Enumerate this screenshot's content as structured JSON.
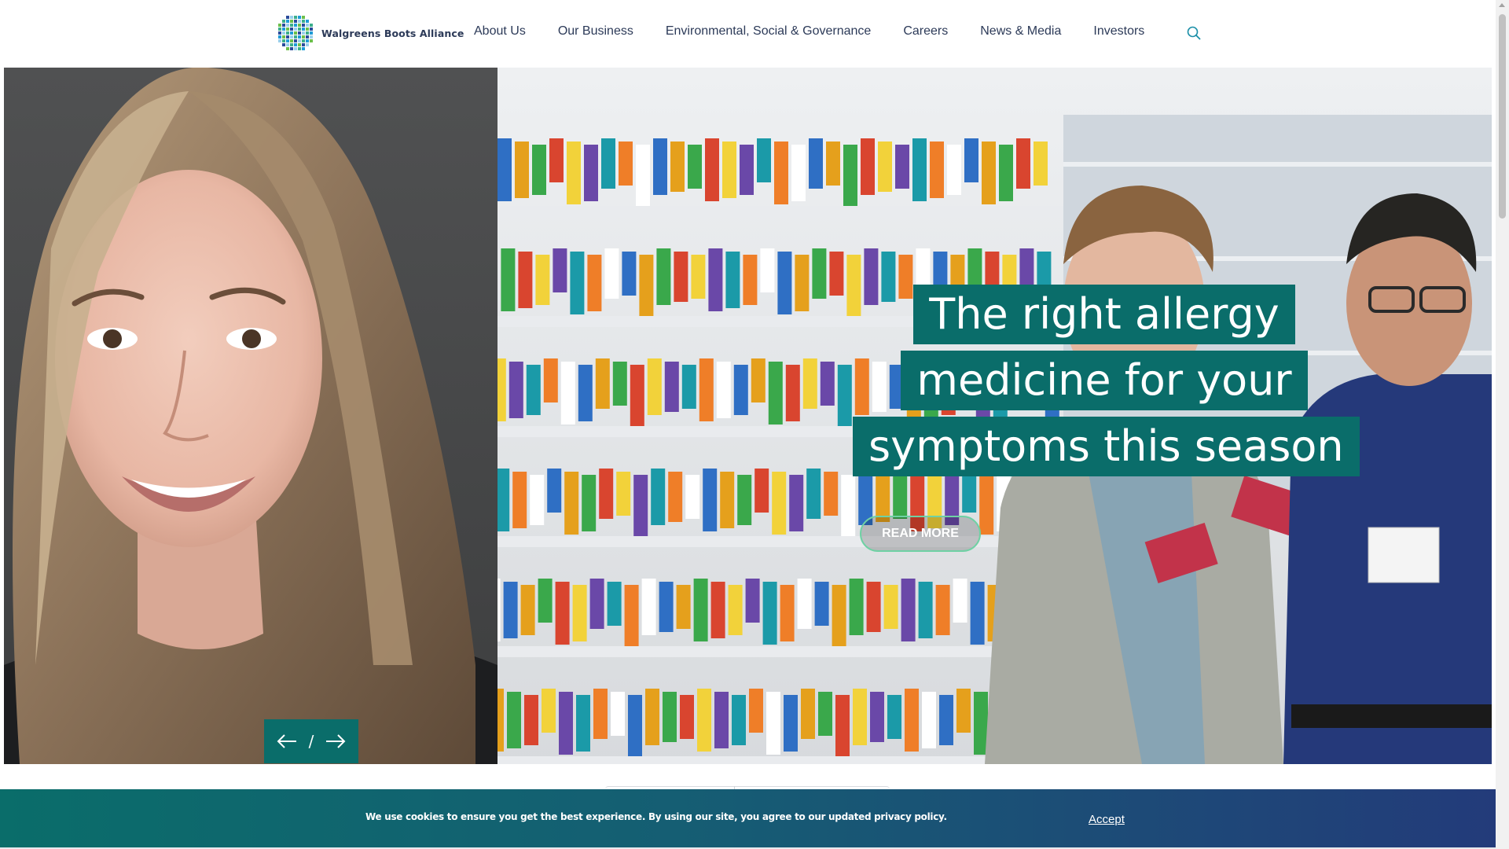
{
  "header": {
    "brand": "Walgreens Boots Alliance",
    "nav": [
      "About Us",
      "Our Business",
      "Environmental, Social & Governance",
      "Careers",
      "News & Media",
      "Investors"
    ],
    "search_icon": "search-icon"
  },
  "hero": {
    "headline_lines": [
      "The right allergy",
      "medicine for your",
      "symptoms this season"
    ],
    "cta_label": "READ MORE",
    "carousel": {
      "prev_icon": "arrow-left-icon",
      "separator": "/",
      "next_icon": "arrow-right-icon"
    },
    "accent_color": "#0a6d6a",
    "cta_border_color": "#6fd1a4"
  },
  "cookie": {
    "message_prefix": "We use cookies to ensure you get the best experience. By using our site, you agree to our updated ",
    "link_text": "privacy policy",
    "message_suffix": ".",
    "accept_label": "Accept"
  }
}
